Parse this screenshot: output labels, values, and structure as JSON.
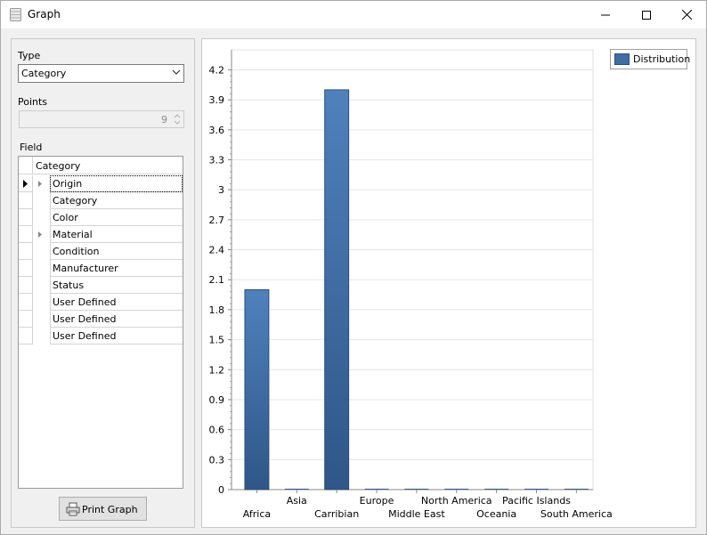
{
  "window": {
    "title": "Graph",
    "controls": [
      "minimize",
      "maximize",
      "close"
    ]
  },
  "left_panel": {
    "type_label": "Type",
    "type_value": "Category",
    "points_label": "Points",
    "points_value": "9",
    "field_label": "Field",
    "field_grid": {
      "header": "Category",
      "rows": [
        {
          "label": "Origin",
          "expandable": true,
          "current": true
        },
        {
          "label": "Category",
          "expandable": false,
          "current": false
        },
        {
          "label": "Color",
          "expandable": false,
          "current": false
        },
        {
          "label": "Material",
          "expandable": true,
          "current": false
        },
        {
          "label": "Condition",
          "expandable": false,
          "current": false
        },
        {
          "label": "Manufacturer",
          "expandable": false,
          "current": false
        },
        {
          "label": "Status",
          "expandable": false,
          "current": false
        },
        {
          "label": "User Defined",
          "expandable": false,
          "current": false
        },
        {
          "label": "User Defined",
          "expandable": false,
          "current": false
        },
        {
          "label": "User Defined",
          "expandable": false,
          "current": false
        }
      ]
    },
    "print_button_label": "Print Graph"
  },
  "chart_data": {
    "type": "bar",
    "categories": [
      "Africa",
      "Asia",
      "Carribian",
      "Europe",
      "Middle East",
      "North America",
      "Oceania",
      "Pacific Islands",
      "South America"
    ],
    "series": [
      {
        "name": "Distribution",
        "values": [
          2,
          0,
          4,
          0,
          0,
          0,
          0,
          0,
          0
        ],
        "color": "#3f6ea6"
      }
    ],
    "yticks": [
      "0",
      "0.3",
      "0.6",
      "0.9",
      "1.2",
      "1.5",
      "1.8",
      "2.1",
      "2.4",
      "2.7",
      "3",
      "3.3",
      "3.6",
      "3.9",
      "4.2"
    ],
    "ylim": [
      0,
      4.4
    ],
    "grid": true,
    "legend_position": "top-right"
  },
  "colors": {
    "bar": "#3f6ea6",
    "bar_dark": "#2f5687",
    "gridline": "#e6e6e6"
  }
}
